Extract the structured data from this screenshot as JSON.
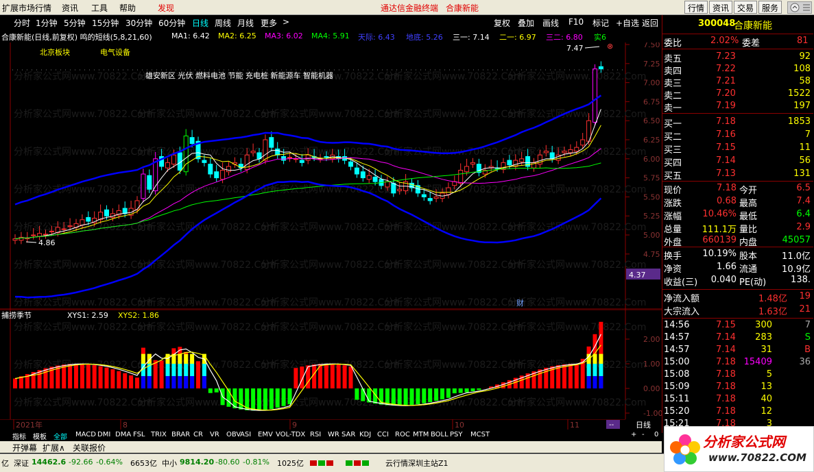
{
  "menubar": {
    "items": [
      "扩展市场行情",
      "资讯",
      "工具",
      "帮助"
    ],
    "discover": "发现",
    "center_links": [
      "通达信金融终端",
      "合康新能"
    ],
    "right_buttons": [
      "行情",
      "资讯",
      "交易",
      "服务"
    ]
  },
  "toolbar": {
    "periods": [
      "分时",
      "1分钟",
      "5分钟",
      "15分钟",
      "30分钟",
      "60分钟",
      "日线",
      "周线",
      "月线",
      "更多",
      ">"
    ],
    "selected": "日线",
    "right": [
      "复权",
      "叠加",
      "画线",
      "F10",
      "标记",
      "+自选",
      "返回"
    ]
  },
  "info": {
    "title": "合康新能(日线,前复权) 鸣的短线(5,8,21,60)",
    "ma1": "MA1: 6.42",
    "ma2": "MA2: 6.25",
    "ma3": "MA3: 6.02",
    "ma4": "MA4: 5.91",
    "up": "天际: 6.43",
    "down": "地底: 5.26",
    "l3": "三一: 7.14",
    "l2": "二一: 6.97",
    "l1": "三二: 6.80",
    "last": "实6"
  },
  "tags": {
    "sector": "北京板块",
    "industry": "电气设备",
    "concepts": "雄安新区 光伏 燃料电池 节能 充电桩 新能源车 智能机器"
  },
  "watermark": "分析家公式网www.70822.Com",
  "main_chart": {
    "y_ticks": [
      "7.50",
      "7.25",
      "7.00",
      "6.75",
      "6.50",
      "6.25",
      "6.00",
      "5.75",
      "5.50",
      "5.25",
      "5.00",
      "4.75"
    ],
    "high_label": "7.47",
    "low_label": "4.86",
    "price_flag": "4.37",
    "finance_marker": "财"
  },
  "sub_chart": {
    "name": "捕捞季节",
    "xys1": "XYS1: 2.59",
    "xys2": "XYS2: 1.86",
    "y_ticks": [
      "2.00",
      "1.00",
      "0.00",
      "-1.00"
    ]
  },
  "time_axis": {
    "labels": [
      "2021年",
      "8",
      "9",
      "10",
      "11"
    ],
    "period_label": "日线",
    "buttons": [
      "+",
      "-",
      "0",
      "1"
    ]
  },
  "indicator_tabs": [
    "指标",
    "模板",
    "全部",
    "MACD",
    "DMI",
    "DMA",
    "FSL",
    "TRIX",
    "BRAR",
    "CR",
    "VR",
    "OBV",
    "ASI",
    "EMV",
    "VOL-TDX",
    "RSI",
    "WR",
    "SAR",
    "KDJ",
    "CCI",
    "ROC",
    "MTM",
    "BOLL",
    "PSY",
    "MCST"
  ],
  "bar2": [
    "开弹幕",
    "扩展∧",
    "关联报价"
  ],
  "quote_panel": {
    "code": "300048",
    "name": "合康新能",
    "weibi_label": "委比",
    "weibi": "2.02%",
    "weicha_label": "委差",
    "weicha": "81",
    "asks": [
      {
        "label": "卖五",
        "price": "7.23",
        "vol": "92"
      },
      {
        "label": "卖四",
        "price": "7.22",
        "vol": "108"
      },
      {
        "label": "卖三",
        "price": "7.21",
        "vol": "58"
      },
      {
        "label": "卖二",
        "price": "7.20",
        "vol": "1522"
      },
      {
        "label": "卖一",
        "price": "7.19",
        "vol": "197"
      }
    ],
    "bids": [
      {
        "label": "买一",
        "price": "7.18",
        "vol": "1853"
      },
      {
        "label": "买二",
        "price": "7.16",
        "vol": "7"
      },
      {
        "label": "买三",
        "price": "7.15",
        "vol": "11"
      },
      {
        "label": "买四",
        "price": "7.14",
        "vol": "56"
      },
      {
        "label": "买五",
        "price": "7.13",
        "vol": "131"
      }
    ],
    "stats": [
      {
        "l1": "现价",
        "v1": "7.18",
        "l2": "今开",
        "v2": "6.5"
      },
      {
        "l1": "涨跌",
        "v1": "0.68",
        "l2": "最高",
        "v2": "7.4"
      },
      {
        "l1": "涨幅",
        "v1": "10.46%",
        "l2": "最低",
        "v2": "6.4"
      },
      {
        "l1": "总量",
        "v1": "111.1万",
        "l2": "量比",
        "v2": "2.9"
      },
      {
        "l1": "外盘",
        "v1": "660139",
        "l2": "内盘",
        "v2": "45057"
      }
    ],
    "stats2": [
      {
        "l1": "换手",
        "v1": "10.19%",
        "l2": "股本",
        "v2": "11.0亿"
      },
      {
        "l1": "净资",
        "v1": "1.66",
        "l2": "流通",
        "v2": "10.9亿"
      },
      {
        "l1": "收益(三)",
        "v1": "0.040",
        "l2": "PE(动)",
        "v2": "138."
      }
    ],
    "flows": [
      {
        "label": "净流入额",
        "v": "1.48亿",
        "v2": "19"
      },
      {
        "label": "大宗流入",
        "v": "1.63亿",
        "v2": "21"
      }
    ],
    "ticks": [
      {
        "t": "14:56",
        "p": "7.15",
        "v": "300",
        "f": "7"
      },
      {
        "t": "14:57",
        "p": "7.14",
        "v": "283",
        "f": "S"
      },
      {
        "t": "14:57",
        "p": "7.14",
        "v": "31",
        "f": "B"
      },
      {
        "t": "15:00",
        "p": "7.18",
        "v": "15409",
        "f": "36"
      },
      {
        "t": "15:08",
        "p": "7.18",
        "v": "5",
        "f": ""
      },
      {
        "t": "15:09",
        "p": "7.18",
        "v": "13",
        "f": ""
      },
      {
        "t": "15:11",
        "p": "7.18",
        "v": "40",
        "f": ""
      },
      {
        "t": "15:20",
        "p": "7.18",
        "v": "12",
        "f": ""
      },
      {
        "t": "15:21",
        "p": "7.18",
        "v": "3",
        "f": ""
      }
    ]
  },
  "status": {
    "prefix": "亿",
    "sz_label": "深证",
    "sz_val": "14462.6",
    "sz_chg": "-92.66",
    "sz_pct": "-0.64%",
    "sz_amt": "6653亿",
    "zx_label": "中小",
    "zx_val": "9814.20",
    "zx_chg": "-80.60",
    "zx_pct": "-0.81%",
    "zx_amt": "1025亿",
    "server": "云行情深圳主站Z1"
  },
  "logo": {
    "name": "分析家公式网",
    "url": "www.70822.COM"
  },
  "colors": {
    "up": "#ff3030",
    "down": "#00ffff",
    "ma1": "#ffffff",
    "ma2": "#ffff00",
    "ma3": "#ff00ff",
    "ma4": "#00ff00",
    "band": "#0000ff"
  }
}
